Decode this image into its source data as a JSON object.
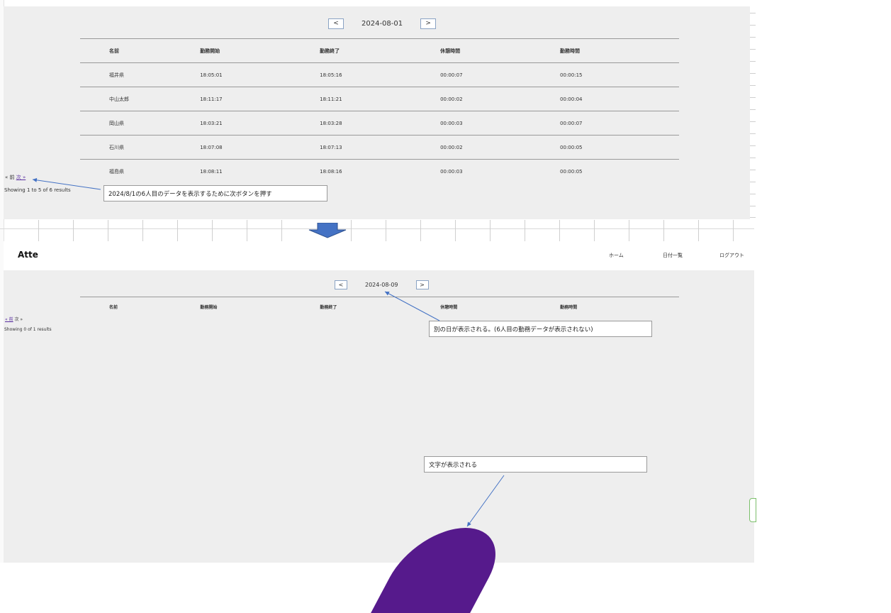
{
  "panel1": {
    "date": "2024-08-01",
    "prev_btn": "<",
    "next_btn": ">",
    "columns": [
      "名前",
      "勤務開始",
      "勤務終了",
      "休憩時間",
      "勤務時間"
    ],
    "rows": [
      [
        "福井県",
        "18:05:01",
        "18:05:16",
        "00:00:07",
        "00:00:15"
      ],
      [
        "中山太郎",
        "18:11:17",
        "18:11:21",
        "00:00:02",
        "00:00:04"
      ],
      [
        "岡山県",
        "18:03:21",
        "18:03:28",
        "00:00:03",
        "00:00:07"
      ],
      [
        "石川県",
        "18:07:08",
        "18:07:13",
        "00:00:02",
        "00:00:05"
      ],
      [
        "福島県",
        "18:08:11",
        "18:08:16",
        "00:00:03",
        "00:00:05"
      ]
    ],
    "pager_prev": "« 前",
    "pager_next": "次 »",
    "showing": "Showing 1 to 5 of 6 results"
  },
  "callouts": {
    "c1": "2024/8/1の6人目のデータを表示するために次ボタンを押す",
    "c2": "別の日が表示される。(6人目の勤務データが表示されない)",
    "c3": "文字が表示される"
  },
  "header": {
    "logo": "Atte",
    "nav": [
      "ホーム",
      "日付一覧",
      "ログアウト"
    ]
  },
  "panel2": {
    "date": "2024-08-09",
    "prev_btn": "<",
    "next_btn": ">",
    "columns": [
      "名前",
      "勤務開始",
      "勤務終了",
      "休憩時間",
      "勤務時間"
    ],
    "pager_prev": "« 前",
    "pager_next": "次 »",
    "showing": "Showing 0 of 1 results"
  },
  "colors": {
    "panel_bg": "#eeeeee",
    "arrow": "#4472c4",
    "blob": "#561a8c",
    "link": "#5a2fa0"
  }
}
